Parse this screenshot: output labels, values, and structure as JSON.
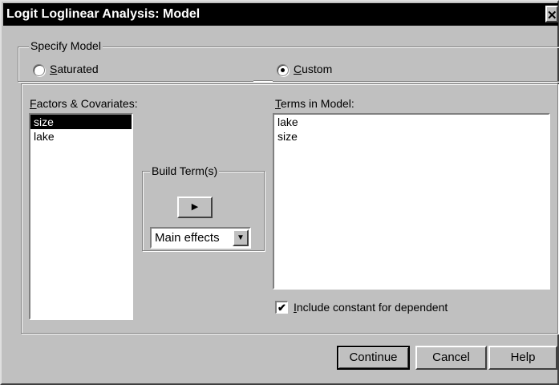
{
  "window": {
    "title": "Logit Loglinear Analysis: Model",
    "close_glyph": "✕"
  },
  "specify_model": {
    "legend": "Specify Model",
    "saturated_label": "Saturated",
    "custom_label": "Custom",
    "selected": "custom"
  },
  "factors": {
    "label": "Factors & Covariates:",
    "items": [
      "size",
      "lake"
    ],
    "selected_index": 0
  },
  "build_term": {
    "legend": "Build Term(s)",
    "arrow_glyph": "▶",
    "type_value": "Main effects",
    "dropdown_glyph": "▼"
  },
  "terms": {
    "label": "Terms in Model:",
    "items": [
      "lake",
      "size"
    ]
  },
  "include_constant": {
    "label": "Include constant for dependent",
    "checked": true,
    "check_glyph": "✔"
  },
  "buttons": {
    "continue": "Continue",
    "cancel": "Cancel",
    "help": "Help"
  }
}
